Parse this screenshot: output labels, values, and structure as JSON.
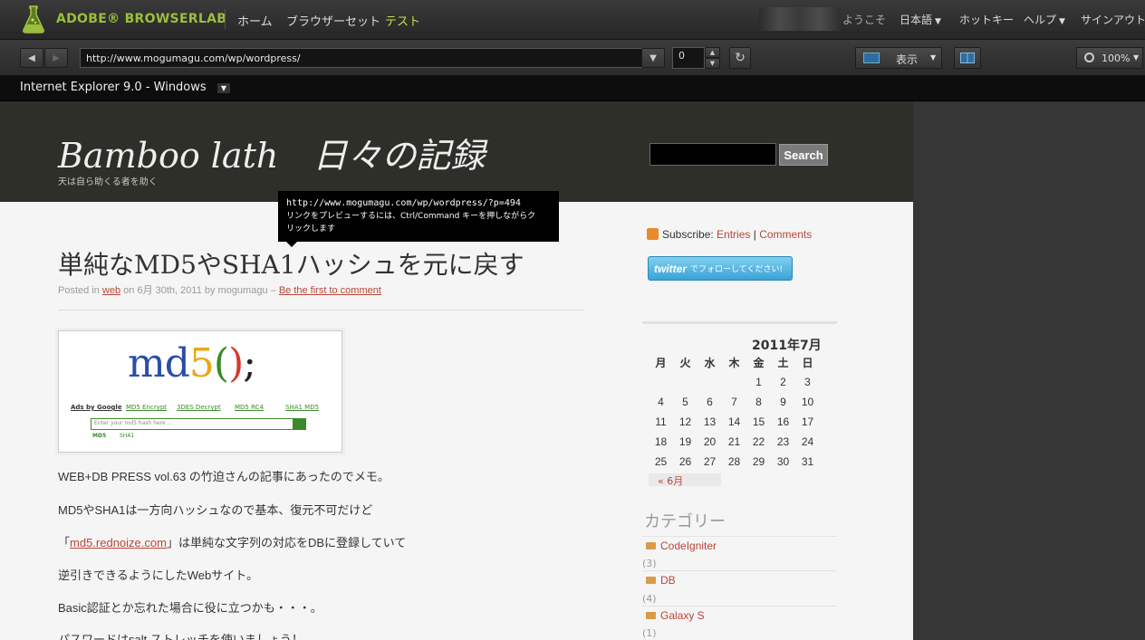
{
  "app": {
    "brand": "ADOBE® BROWSERLAB",
    "nav": [
      "ホーム",
      "ブラウザーセット",
      "テスト"
    ],
    "active_nav": "テスト",
    "welcome": "ようこそ",
    "language": "日本語",
    "hotkeys": "ホットキー",
    "help": "ヘルプ",
    "signout": "サインアウト"
  },
  "toolbar": {
    "url": "http://www.mogumagu.com/wp/wordpress/",
    "delay": "0",
    "view_label": "表示",
    "zoom": "100%"
  },
  "browser": {
    "selected": "Internet Explorer 9.0 - Windows"
  },
  "site": {
    "title": "Bamboo lath　日々の記録",
    "tagline": "天は自ら助くる者を助く",
    "search_button": "Search"
  },
  "tooltip": {
    "url": "http://www.mogumagu.com/wp/wordpress/?p=494",
    "text_line1": "リンクをプレビューするには、Ctrl/Command キーを押しながらク",
    "text_line2": "リックします"
  },
  "post": {
    "title": "単純なMD5やSHA1ハッシュを元に戻す",
    "meta_posted": "Posted in ",
    "meta_category": "web",
    "meta_on": " on 6月 30th, 2011 by mogumagu – ",
    "meta_comment": "Be the first to comment",
    "image": {
      "logo": "md5()",
      "ads_label": "Ads by Google",
      "ads_links": [
        "MD5 Encrypt",
        "3DES Decrypt",
        "MD5 RC4",
        "SHA1 MD5"
      ],
      "placeholder": "Enter your md5 hash here ...",
      "tabs": [
        "MD5",
        "SHA1"
      ]
    },
    "paragraphs": [
      "WEB+DB PRESS  vol.63 の竹迫さんの記事にあったのでメモ。",
      "MD5やSHA1は一方向ハッシュなので基本、復元不可だけど",
      "」は単純な文字列の対応をDBに登録していて",
      "逆引きできるようにしたWebサイト。",
      "Basic認証とか忘れた場合に役に立つかも・・・。",
      "パスワードはsalt ストレッチを使いましょう！"
    ],
    "link_open": "「",
    "link_text": "md5.rednoize.com"
  },
  "sidebar": {
    "subscribe_label": "Subscribe: ",
    "entries": "Entries",
    "separator": " | ",
    "comments": "Comments",
    "twitter_logo": "twitter",
    "twitter_text": "でフォローしてください!",
    "calendar": {
      "caption": "2011年7月",
      "weekdays": [
        "月",
        "火",
        "水",
        "木",
        "金",
        "土",
        "日"
      ],
      "weeks": [
        [
          "",
          "",
          "",
          "",
          "1",
          "2",
          "3"
        ],
        [
          "4",
          "5",
          "6",
          "7",
          "8",
          "9",
          "10"
        ],
        [
          "11",
          "12",
          "13",
          "14",
          "15",
          "16",
          "17"
        ],
        [
          "18",
          "19",
          "20",
          "21",
          "22",
          "23",
          "24"
        ],
        [
          "25",
          "26",
          "27",
          "28",
          "29",
          "30",
          "31"
        ]
      ],
      "prev": "« 6月"
    },
    "categories_heading": "カテゴリー",
    "categories": [
      {
        "name": "CodeIgniter",
        "count": "(3)"
      },
      {
        "name": "DB",
        "count": "(4)"
      },
      {
        "name": "Galaxy S",
        "count": "(1)"
      }
    ]
  }
}
